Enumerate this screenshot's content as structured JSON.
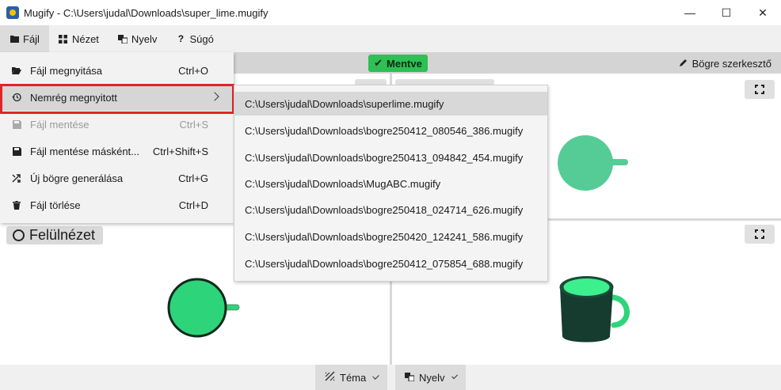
{
  "window": {
    "title": "Mugify - C:\\Users\\judal\\Downloads\\super_lime.mugify",
    "minimize": "—",
    "maximize": "☐",
    "close": "✕"
  },
  "menubar": {
    "items": [
      {
        "label": "Fájl",
        "icon": "folder-icon"
      },
      {
        "label": "Nézet",
        "icon": "grid-icon"
      },
      {
        "label": "Nyelv",
        "icon": "translate-icon"
      },
      {
        "label": "Súgó",
        "icon": "question-icon"
      }
    ]
  },
  "file_menu": {
    "items": [
      {
        "label": "Fájl megnyitása",
        "shortcut": "Ctrl+O",
        "icon": "folder-open-icon",
        "disabled": false
      },
      {
        "label": "Nemrég megnyitott",
        "shortcut": "",
        "icon": "history-icon",
        "disabled": false,
        "submenu": true
      },
      {
        "label": "Fájl mentése",
        "shortcut": "Ctrl+S",
        "icon": "save-icon",
        "disabled": true
      },
      {
        "label": "Fájl mentése másként...",
        "shortcut": "Ctrl+Shift+S",
        "icon": "save-as-icon",
        "disabled": false
      },
      {
        "label": "Új bögre generálása",
        "shortcut": "Ctrl+G",
        "icon": "shuffle-icon",
        "disabled": false
      },
      {
        "label": "Fájl törlése",
        "shortcut": "Ctrl+D",
        "icon": "trash-icon",
        "disabled": false
      }
    ]
  },
  "recent_menu": {
    "items": [
      "C:\\Users\\judal\\Downloads\\superlime.mugify",
      "C:\\Users\\judal\\Downloads\\bogre250412_080546_386.mugify",
      "C:\\Users\\judal\\Downloads\\bogre250413_094842_454.mugify",
      "C:\\Users\\judal\\Downloads\\MugABC.mugify",
      "C:\\Users\\judal\\Downloads\\bogre250418_024714_626.mugify",
      "C:\\Users\\judal\\Downloads\\bogre250420_124241_586.mugify",
      "C:\\Users\\judal\\Downloads\\bogre250412_075854_688.mugify"
    ]
  },
  "status": {
    "saved_label": "Mentve",
    "edit_label": "Bögre szerkesztő"
  },
  "views": {
    "top_view_label": "Felülnézet"
  },
  "bottombar": {
    "theme_label": "Téma",
    "language_label": "Nyelv"
  },
  "colors": {
    "accent_green": "#2ebf55",
    "mug_green": "#2ed47a",
    "mug_pale_green": "#55cc96",
    "highlight_red": "#e2232a"
  }
}
